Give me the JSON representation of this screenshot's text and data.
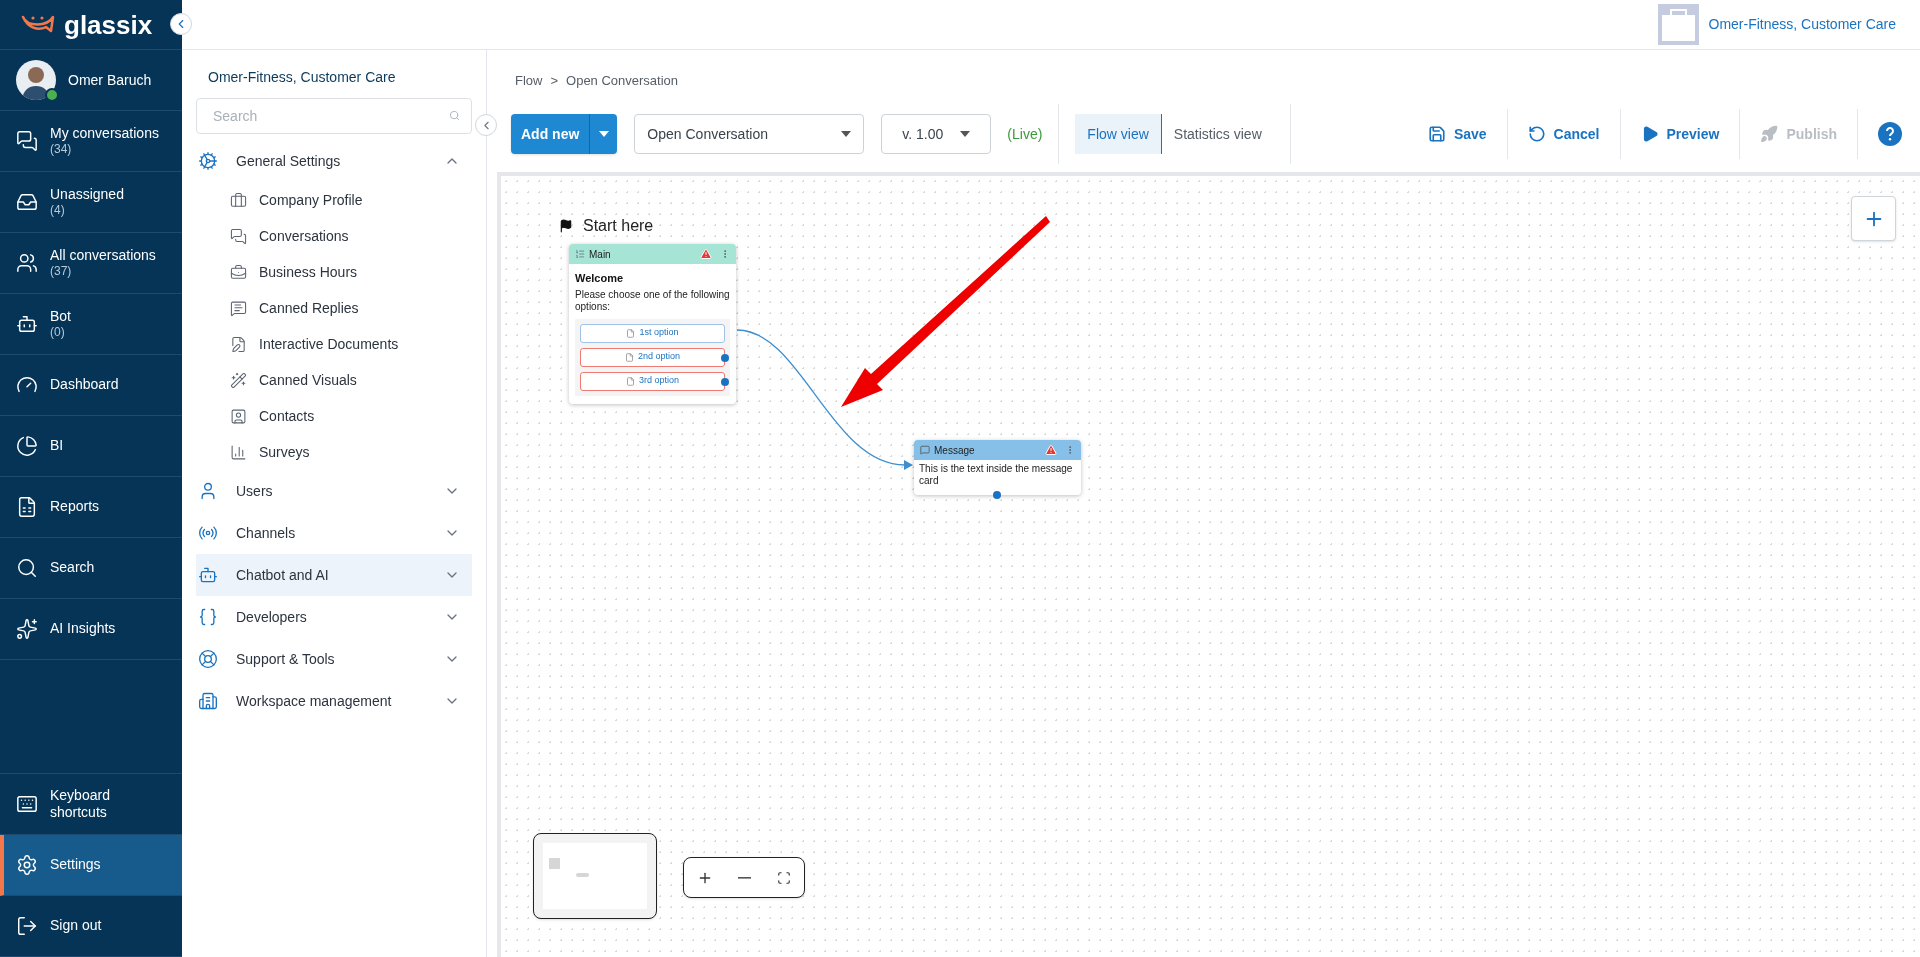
{
  "brand": {
    "name": "glassix"
  },
  "user": {
    "name": "Omer Baruch",
    "online": true
  },
  "nav": [
    {
      "label": "My conversations",
      "count": "(34)",
      "selected": false
    },
    {
      "label": "Unassigned",
      "count": "(4)",
      "selected": false
    },
    {
      "label": "All conversations",
      "count": "(37)",
      "selected": false
    },
    {
      "label": "Bot",
      "count": "(0)",
      "selected": false
    },
    {
      "label": "Dashboard",
      "selected": false
    },
    {
      "label": "BI",
      "selected": false
    },
    {
      "label": "Reports",
      "selected": false
    },
    {
      "label": "Search",
      "selected": false
    },
    {
      "label": "AI Insights",
      "selected": false
    }
  ],
  "nav_bottom": [
    {
      "label": "Keyboard shortcuts",
      "selected": false
    },
    {
      "label": "Settings",
      "selected": true
    },
    {
      "label": "Sign out",
      "selected": false
    }
  ],
  "header": {
    "workspace": "Omer-Fitness, Customer Care"
  },
  "settings_sidebar": {
    "workspace": "Omer-Fitness, Customer Care",
    "search": {
      "placeholder": "Search"
    },
    "sections": [
      {
        "label": "General Settings",
        "expanded": true,
        "selected": false,
        "children": [
          {
            "label": "Company Profile"
          },
          {
            "label": "Conversations"
          },
          {
            "label": "Business Hours"
          },
          {
            "label": "Canned Replies"
          },
          {
            "label": "Interactive Documents"
          },
          {
            "label": "Canned Visuals"
          },
          {
            "label": "Contacts"
          },
          {
            "label": "Surveys"
          }
        ]
      },
      {
        "label": "Users",
        "expanded": false,
        "selected": false
      },
      {
        "label": "Channels",
        "expanded": false,
        "selected": false
      },
      {
        "label": "Chatbot and AI",
        "expanded": false,
        "selected": true
      },
      {
        "label": "Developers",
        "expanded": false,
        "selected": false
      },
      {
        "label": "Support & Tools",
        "expanded": false,
        "selected": false
      },
      {
        "label": "Workspace management",
        "expanded": false,
        "selected": false
      }
    ]
  },
  "breadcrumb": {
    "separator": ">",
    "items": [
      "Flow",
      "Open Conversation"
    ]
  },
  "toolbar": {
    "add_new": "Add new",
    "flow_select": {
      "value": "Open Conversation"
    },
    "version_select": {
      "value": "v. 1.00"
    },
    "status": "(Live)",
    "views": [
      {
        "label": "Flow view",
        "selected": true
      },
      {
        "label": "Statistics view",
        "selected": false
      }
    ],
    "actions": [
      {
        "label": "Save",
        "disabled": false
      },
      {
        "label": "Cancel",
        "disabled": false
      },
      {
        "label": "Preview",
        "disabled": false
      },
      {
        "label": "Publish",
        "disabled": true
      }
    ]
  },
  "canvas": {
    "start_label": "Start here",
    "nodes": [
      {
        "kind": "menu",
        "title": "Main",
        "warning": true,
        "heading": "Welcome",
        "text": "Please choose one of the following options:",
        "options": [
          {
            "label": "1st option",
            "connected": true
          },
          {
            "label": "2nd option",
            "connected": false
          },
          {
            "label": "3rd option",
            "connected": false
          }
        ]
      },
      {
        "kind": "message",
        "title": "Message",
        "warning": true,
        "text": "This is the text inside the message card"
      }
    ]
  }
}
